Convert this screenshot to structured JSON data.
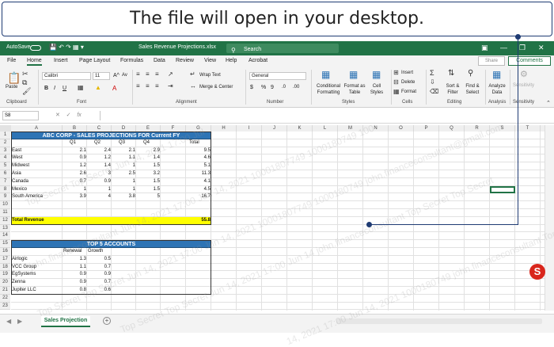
{
  "callout": {
    "text": "The file will open in your desktop."
  },
  "titlebar": {
    "autosave": "AutoSave",
    "autosave_state": "Off",
    "filename": "Sales Revenue Projections.xlsx",
    "search_placeholder": "Search",
    "color": "#217346"
  },
  "menu": {
    "tabs": [
      "File",
      "Home",
      "Insert",
      "Page Layout",
      "Formulas",
      "Data",
      "Review",
      "View",
      "Help",
      "Acrobat"
    ],
    "share": "Share",
    "comments": "Comments"
  },
  "ribbon": {
    "clipboard": {
      "paste": "Paste",
      "label": "Clipboard"
    },
    "font": {
      "name": "Calibri",
      "size": "11",
      "label": "Font"
    },
    "alignment": {
      "wrap": "Wrap Text",
      "merge": "Merge & Center",
      "label": "Alignment"
    },
    "number": {
      "format": "General",
      "label": "Number"
    },
    "styles": {
      "conditional": "Conditional Formatting",
      "format_table": "Format as Table",
      "cell_styles": "Cell Styles",
      "label": "Styles"
    },
    "cells": {
      "insert": "Insert",
      "delete": "Delete",
      "format": "Format",
      "label": "Cells"
    },
    "editing": {
      "sort": "Sort & Filter",
      "find": "Find & Select",
      "label": "Editing"
    },
    "analysis": {
      "analyze": "Analyze Data",
      "label": "Analysis"
    },
    "sensitivity": {
      "btn": "Sensitivity",
      "label": "Sensitivity"
    }
  },
  "formula_bar": {
    "name_box": "S8",
    "fx": "fx",
    "value": ""
  },
  "columns": [
    "A",
    "B",
    "C",
    "D",
    "E",
    "F",
    "G",
    "H",
    "I",
    "J",
    "K",
    "L",
    "M",
    "N",
    "O",
    "P",
    "Q",
    "R",
    "S",
    "T",
    "U"
  ],
  "rows": [
    "1",
    "2",
    "3",
    "4",
    "5",
    "6",
    "7",
    "8",
    "9",
    "10",
    "11",
    "12",
    "13",
    "14",
    "15",
    "16",
    "17",
    "18",
    "19",
    "20",
    "21",
    "22",
    "23"
  ],
  "sheet": {
    "title1": "ABC CORP  - SALES PROJECTIONS FOR Current FY",
    "headers": [
      "Q1",
      "Q2",
      "Q3",
      "Q4",
      "Total"
    ],
    "data": [
      {
        "region": "East",
        "q1": "2.1",
        "q2": "2.4",
        "q3": "2.1",
        "q4": "2.9",
        "total": "9.5"
      },
      {
        "region": "West",
        "q1": "0.9",
        "q2": "1.2",
        "q3": "1.1",
        "q4": "1.4",
        "total": "4.6"
      },
      {
        "region": "Midwest",
        "q1": "1.2",
        "q2": "1.4",
        "q3": "1",
        "q4": "1.5",
        "total": "5.1"
      },
      {
        "region": "Asia",
        "q1": "2.6",
        "q2": "3",
        "q3": "2.5",
        "q4": "3.2",
        "total": "11.3"
      },
      {
        "region": "Canada",
        "q1": "0.7",
        "q2": "0.9",
        "q3": "1",
        "q4": "1.5",
        "total": "4.1"
      },
      {
        "region": "Mexico",
        "q1": "1",
        "q2": "1",
        "q3": "1",
        "q4": "1.5",
        "total": "4.5"
      },
      {
        "region": "South America",
        "q1": "3.9",
        "q2": "4",
        "q3": "3.8",
        "q4": "5",
        "total": "16.7"
      }
    ],
    "total_label": "Total Revenue",
    "total_value": "55.8",
    "title2": "TOP 5 ACCOUNTS",
    "acct_headers": [
      "Renewal",
      "Growth"
    ],
    "accounts": [
      {
        "name": "Airlogic",
        "renewal": "1.3",
        "growth": "0.5"
      },
      {
        "name": "VCC Group",
        "renewal": "1.1",
        "growth": "0.7"
      },
      {
        "name": "EgSystems",
        "renewal": "0.9",
        "growth": "0.9"
      },
      {
        "name": "Zenna",
        "renewal": "0.9",
        "growth": "0.7"
      },
      {
        "name": "Jupiter LLC",
        "renewal": "0.8",
        "growth": "0.6"
      }
    ],
    "tab_name": "Sales Projection",
    "title_bg": "#2e74b5",
    "total_bg": "#ffff00"
  },
  "watermark": {
    "lines": [
      "Top Secret Top Secret  Jun 14, 2021 17:00 Jul",
      "john.financeconsultant  Jun 14, 2021 17:00 Jun 14, 2021 10001807749 1000180749 100",
      "Top Secret Top Secret  Jun 14, 2021 17:00 Jun 14, 2021 10001807749 1000180749 john.financeconsultant@gmail.com",
      "Top Secret Top Secret  Jun 14, 2021 17:00 Jun 14  john.financeconsultant  Top Secret Top Secret",
      "14, 2021 17:00 Jun 14, 2021  1000180749 john.financeconsultant  Top Secret Top Secret"
    ]
  }
}
